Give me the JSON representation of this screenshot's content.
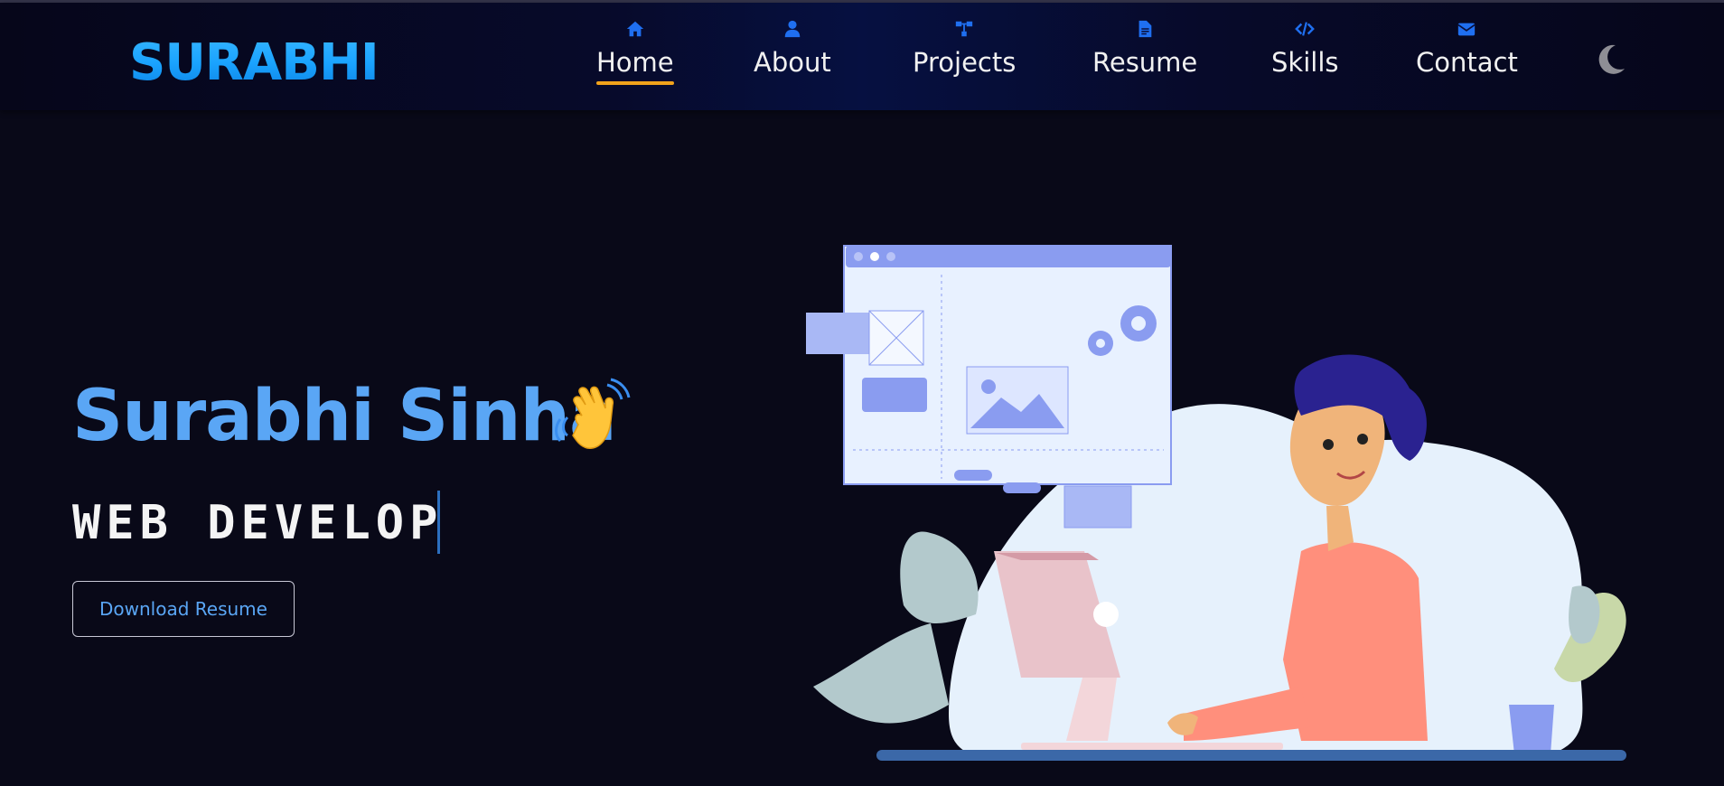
{
  "logo": {
    "text": "SURABHI"
  },
  "nav": {
    "items": [
      {
        "label": "Home",
        "icon": "home-icon",
        "active": true
      },
      {
        "label": "About",
        "icon": "user-icon",
        "active": false
      },
      {
        "label": "Projects",
        "icon": "sitemap-icon",
        "active": false
      },
      {
        "label": "Resume",
        "icon": "document-icon",
        "active": false
      },
      {
        "label": "Skills",
        "icon": "code-icon",
        "active": false
      },
      {
        "label": "Contact",
        "icon": "envelope-icon",
        "active": false
      }
    ],
    "theme_toggle_icon": "moon-icon"
  },
  "hero": {
    "name": "Surabhi Sinha",
    "wave_icon": "waving-hand-icon",
    "role_typed": "WEB DEVELOP",
    "download_label": "Download Resume"
  },
  "colors": {
    "background": "#090918",
    "accent_blue": "#5aa6f5",
    "logo_blue": "#1aa3ff",
    "nav_icon_blue": "#1f6ff0",
    "active_underline": "#f2a31b"
  }
}
